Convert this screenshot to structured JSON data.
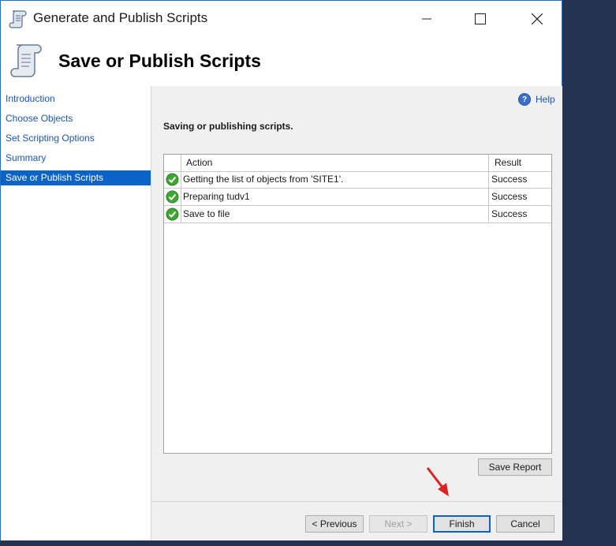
{
  "window": {
    "title": "Generate and Publish Scripts",
    "page_title": "Save or Publish Scripts"
  },
  "sidebar": {
    "items": [
      {
        "label": "Introduction",
        "selected": false
      },
      {
        "label": "Choose Objects",
        "selected": false
      },
      {
        "label": "Set Scripting Options",
        "selected": false
      },
      {
        "label": "Summary",
        "selected": false
      },
      {
        "label": "Save or Publish Scripts",
        "selected": true
      }
    ]
  },
  "content": {
    "help_label": "Help",
    "status_text": "Saving or publishing scripts.",
    "grid": {
      "columns": [
        "Action",
        "Result"
      ],
      "rows": [
        {
          "icon": "success-check-icon",
          "action": "Getting the list of objects from 'SITE1'.",
          "result": "Success"
        },
        {
          "icon": "success-check-icon",
          "action": "Preparing tudv1",
          "result": "Success"
        },
        {
          "icon": "success-check-icon",
          "action": "Save to file",
          "result": "Success"
        }
      ]
    },
    "save_report_label": "Save Report"
  },
  "footer": {
    "previous_label": "< Previous",
    "next_label": "Next >",
    "finish_label": "Finish",
    "cancel_label": "Cancel"
  },
  "colors": {
    "selected_item": "#0b63c6",
    "link": "#1a56b0",
    "success": "#3fa535",
    "annotation_arrow": "#e02020",
    "desktop": "#243352"
  }
}
